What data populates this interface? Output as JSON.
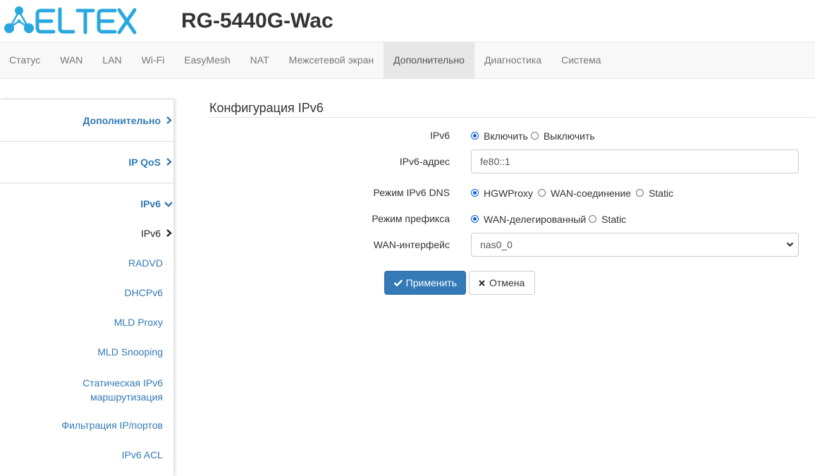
{
  "header": {
    "brand": "ELTEX",
    "model": "RG-5440G-Wac"
  },
  "nav": {
    "items": [
      {
        "label": "Статус",
        "active": false
      },
      {
        "label": "WAN",
        "active": false
      },
      {
        "label": "LAN",
        "active": false
      },
      {
        "label": "Wi-Fi",
        "active": false
      },
      {
        "label": "EasyMesh",
        "active": false
      },
      {
        "label": "NAT",
        "active": false
      },
      {
        "label": "Межсетевой экран",
        "active": false
      },
      {
        "label": "Дополнительно",
        "active": true
      },
      {
        "label": "Диагностика",
        "active": false
      },
      {
        "label": "Система",
        "active": false
      }
    ]
  },
  "sidebar": {
    "groups": [
      {
        "label": "Дополнительно",
        "state": "collapsed"
      },
      {
        "label": "IP QoS",
        "state": "collapsed"
      },
      {
        "label": "IPv6",
        "state": "expanded"
      }
    ],
    "items": [
      {
        "label": "IPv6",
        "current": true
      },
      {
        "label": "RADVD"
      },
      {
        "label": "DHCPv6"
      },
      {
        "label": "MLD Proxy"
      },
      {
        "label": "MLD Snooping"
      },
      {
        "label": "Статическая IPv6",
        "label2": "маршрутизация"
      },
      {
        "label": "Фильтрация IP/портов"
      },
      {
        "label": "IPv6 ACL"
      }
    ]
  },
  "form": {
    "title": "Конфигурация IPv6",
    "ipv6": {
      "label": "IPv6",
      "options": [
        "Включить",
        "Выключить"
      ],
      "selected": "Включить"
    },
    "address": {
      "label": "IPv6-адрес",
      "value": "fe80::1"
    },
    "dns_mode": {
      "label": "Режим IPv6 DNS",
      "options": [
        "HGWProxy",
        "WAN-соединение",
        "Static"
      ],
      "selected": "HGWProxy"
    },
    "prefix_mode": {
      "label": "Режим префикса",
      "options": [
        "WAN-делегированный",
        "Static"
      ],
      "selected": "WAN-делегированный"
    },
    "wan_iface": {
      "label": "WAN-интерфейс",
      "value": "nas0_0"
    },
    "apply_label": "Применить",
    "cancel_label": "Отмена"
  },
  "colors": {
    "brand": "#29a8df",
    "link": "#337ab7",
    "primary_button": "#337ab7"
  }
}
